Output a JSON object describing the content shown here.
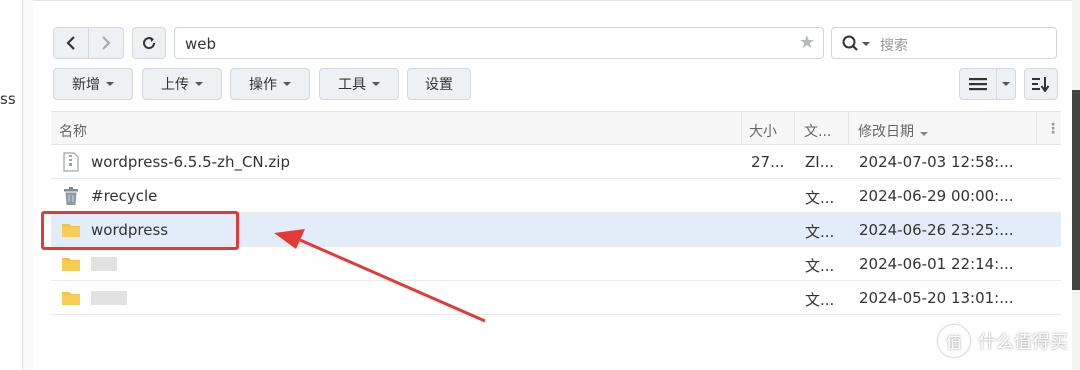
{
  "left_fragment": "ss",
  "toolbar": {
    "back": "‹",
    "forward": "›",
    "refresh": "↻",
    "path": "web",
    "search_placeholder": "搜索",
    "buttons": [
      "新增",
      "上传",
      "操作",
      "工具",
      "设置"
    ]
  },
  "table": {
    "headers": {
      "name": "名称",
      "size": "大小",
      "type": "文...",
      "modified": "修改日期"
    },
    "rows": [
      {
        "name": "wordpress-6.5.5-zh_CN.zip",
        "size": "27...",
        "type": "ZI...",
        "date": "2024-07-03 12:58:...",
        "icon": "zip-file-icon"
      },
      {
        "name": "#recycle",
        "size": "",
        "type": "文...",
        "date": "2024-06-29 00:00:...",
        "icon": "trash-icon"
      },
      {
        "name": "wordpress",
        "size": "",
        "type": "文...",
        "date": "2024-06-26 23:25:...",
        "icon": "folder-icon"
      },
      {
        "name": "",
        "size": "",
        "type": "文...",
        "date": "2024-06-01 22:14:...",
        "icon": "folder-icon"
      },
      {
        "name": "",
        "size": "",
        "type": "文...",
        "date": "2024-05-20 13:01:...",
        "icon": "folder-icon"
      }
    ]
  },
  "watermark": {
    "glyph": "值",
    "text": "什么值得买"
  },
  "colors": {
    "accent_red": "#e53935",
    "folder": "#f5c242",
    "selected_row": "#e2edf9"
  }
}
